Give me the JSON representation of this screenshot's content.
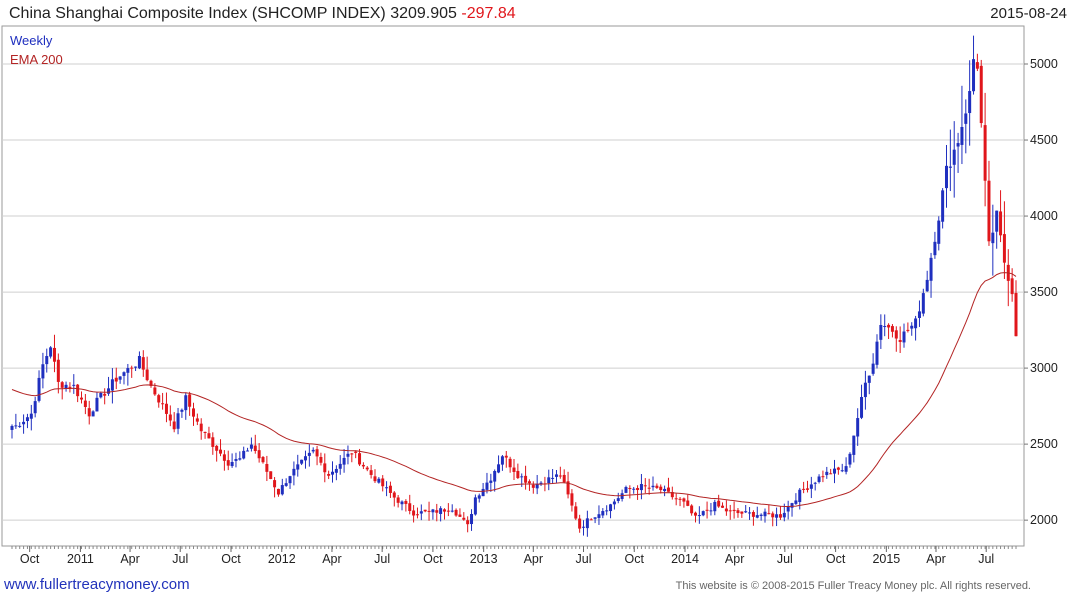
{
  "header": {
    "title": "China Shanghai Composite Index (SHCOMP INDEX) 3209.905",
    "change": "-297.84",
    "date": "2015-08-24"
  },
  "footer": {
    "site": "www.fullertreacymoney.com",
    "notice": "This website is © 2008-2015 Fuller Treacy Money plc. All rights reserved."
  },
  "chart_data": {
    "type": "candlestick",
    "legend": [
      {
        "label": "Weekly",
        "color": "#1f2fbf"
      },
      {
        "label": "EMA 200",
        "color": "#b32424"
      }
    ],
    "y_ticks": [
      "2000",
      "2500",
      "3000",
      "3500",
      "4000",
      "4500",
      "5000"
    ],
    "y_range": [
      1830,
      5250
    ],
    "x_ticks": [
      "Oct",
      "2011",
      "Apr",
      "Jul",
      "Oct",
      "2012",
      "Apr",
      "Jul",
      "Oct",
      "2013",
      "Apr",
      "Jul",
      "Oct",
      "2014",
      "Apr",
      "Jul",
      "Oct",
      "2015",
      "Apr",
      "Jul"
    ],
    "x_start": "2010-08-30",
    "x_end": "2015-08-24",
    "colors": {
      "up": "#1f2fbf",
      "down": "#e0161b",
      "ema": "#b32424",
      "grid": "#cfcfcf"
    },
    "close_anchors": [
      [
        "2010-09-06",
        2620
      ],
      [
        "2010-10-04",
        2700
      ],
      [
        "2010-10-25",
        3020
      ],
      [
        "2010-11-08",
        3150
      ],
      [
        "2010-11-22",
        2900
      ],
      [
        "2010-12-20",
        2880
      ],
      [
        "2011-01-17",
        2700
      ],
      [
        "2011-01-31",
        2780
      ],
      [
        "2011-03-07",
        2930
      ],
      [
        "2011-04-18",
        3050
      ],
      [
        "2011-05-09",
        2880
      ],
      [
        "2011-06-20",
        2620
      ],
      [
        "2011-07-11",
        2800
      ],
      [
        "2011-08-08",
        2590
      ],
      [
        "2011-09-26",
        2380
      ],
      [
        "2011-10-17",
        2400
      ],
      [
        "2011-11-07",
        2500
      ],
      [
        "2011-12-05",
        2320
      ],
      [
        "2011-12-26",
        2180
      ],
      [
        "2012-01-16",
        2300
      ],
      [
        "2012-02-27",
        2450
      ],
      [
        "2012-03-26",
        2300
      ],
      [
        "2012-05-07",
        2450
      ],
      [
        "2012-06-11",
        2300
      ],
      [
        "2012-07-23",
        2150
      ],
      [
        "2012-08-27",
        2050
      ],
      [
        "2012-09-24",
        2050
      ],
      [
        "2012-11-05",
        2080
      ],
      [
        "2012-12-03",
        1960
      ],
      [
        "2012-12-17",
        2150
      ],
      [
        "2013-01-14",
        2280
      ],
      [
        "2013-02-04",
        2430
      ],
      [
        "2013-03-04",
        2300
      ],
      [
        "2013-04-01",
        2230
      ],
      [
        "2013-05-20",
        2300
      ],
      [
        "2013-06-24",
        1950
      ],
      [
        "2013-07-15",
        2020
      ],
      [
        "2013-08-19",
        2100
      ],
      [
        "2013-09-16",
        2200
      ],
      [
        "2013-10-14",
        2220
      ],
      [
        "2013-11-18",
        2200
      ],
      [
        "2013-12-30",
        2110
      ],
      [
        "2014-01-20",
        2010
      ],
      [
        "2014-02-24",
        2100
      ],
      [
        "2014-03-24",
        2050
      ],
      [
        "2014-05-05",
        2040
      ],
      [
        "2014-06-23",
        2030
      ],
      [
        "2014-07-28",
        2180
      ],
      [
        "2014-09-08",
        2300
      ],
      [
        "2014-10-20",
        2340
      ],
      [
        "2014-11-24",
        2900
      ],
      [
        "2014-12-08",
        3050
      ],
      [
        "2014-12-22",
        3300
      ],
      [
        "2015-01-12",
        3250
      ],
      [
        "2015-01-26",
        3200
      ],
      [
        "2015-02-23",
        3300
      ],
      [
        "2015-03-16",
        3600
      ],
      [
        "2015-04-06",
        4000
      ],
      [
        "2015-04-20",
        4300
      ],
      [
        "2015-05-11",
        4500
      ],
      [
        "2015-06-01",
        4800
      ],
      [
        "2015-06-12",
        5166
      ],
      [
        "2015-06-22",
        4600
      ],
      [
        "2015-07-06",
        3800
      ],
      [
        "2015-07-20",
        4000
      ],
      [
        "2015-08-03",
        3700
      ],
      [
        "2015-08-17",
        3507
      ],
      [
        "2015-08-24",
        3210
      ]
    ]
  }
}
